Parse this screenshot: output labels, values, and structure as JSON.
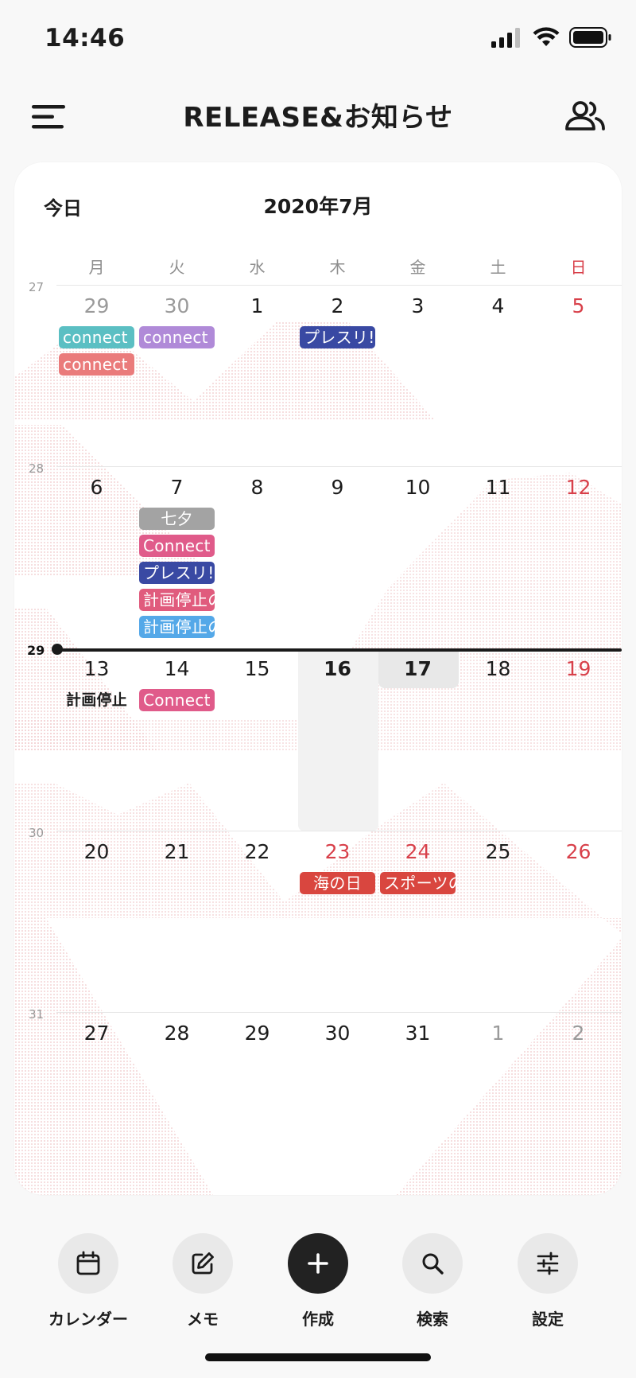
{
  "status_bar": {
    "time": "14:46"
  },
  "header": {
    "title": "RELEASE&お知らせ"
  },
  "calendar": {
    "today_label": "今日",
    "month_title": "2020年7月",
    "weekdays": [
      "月",
      "火",
      "水",
      "木",
      "金",
      "土",
      "日"
    ],
    "weeks": [
      {
        "num": "27",
        "days": [
          "29",
          "30",
          "1",
          "2",
          "3",
          "4",
          "5"
        ]
      },
      {
        "num": "28",
        "days": [
          "6",
          "7",
          "8",
          "9",
          "10",
          "11",
          "12"
        ]
      },
      {
        "num": "29",
        "days": [
          "13",
          "14",
          "15",
          "16",
          "17",
          "18",
          "19"
        ]
      },
      {
        "num": "30",
        "days": [
          "20",
          "21",
          "22",
          "23",
          "24",
          "25",
          "26"
        ]
      },
      {
        "num": "31",
        "days": [
          "27",
          "28",
          "29",
          "30",
          "31",
          "1",
          "2"
        ]
      }
    ],
    "events": {
      "w27_mon_1": {
        "label": "connect",
        "color": "#5bbfc3"
      },
      "w27_mon_2": {
        "label": "connect",
        "color": "#ea7b7b"
      },
      "w27_tue_1": {
        "label": "connect",
        "color": "#b08ad8"
      },
      "w27_thu_1": {
        "label": "プレスリ!",
        "color": "#3949a3"
      },
      "w28_tue_1": {
        "label": "七夕",
        "color": "#a3a3a3"
      },
      "w28_tue_2": {
        "label": "Connect",
        "color": "#e05b8a"
      },
      "w28_tue_3": {
        "label": "プレスリ!",
        "color": "#3949a3"
      },
      "w28_tue_4": {
        "label": "計画停止の",
        "color": "#e05b7d"
      },
      "w28_tue_5": {
        "label": "計画停止の",
        "color": "#54a8e8"
      },
      "w29_mon_1": {
        "label": "計画停止",
        "color": "transparent"
      },
      "w29_tue_1": {
        "label": "Connect",
        "color": "#e05b8a"
      },
      "w30_thu_1": {
        "label": "海の日",
        "color": "#d9463f"
      },
      "w30_fri_1": {
        "label": "スポーツの",
        "color": "#d9463f"
      }
    }
  },
  "bottom_nav": {
    "calendar": {
      "label": "カレンダー",
      "icon": "calendar-icon"
    },
    "memo": {
      "label": "メモ",
      "icon": "edit-icon"
    },
    "create": {
      "label": "作成",
      "icon": "plus-icon"
    },
    "search": {
      "label": "検索",
      "icon": "search-icon"
    },
    "settings": {
      "label": "設定",
      "icon": "sliders-icon"
    }
  }
}
